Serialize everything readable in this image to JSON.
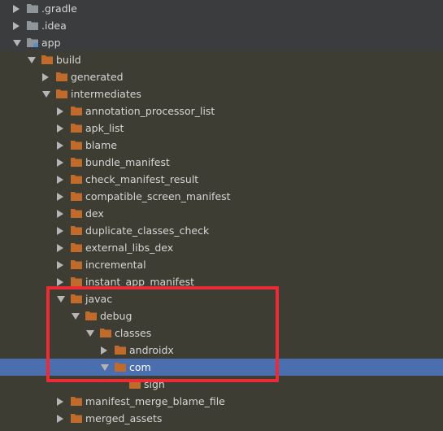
{
  "colors": {
    "background": "#3e3d33",
    "selection": "#4b6eaf",
    "folder_orange": "#c06a2c",
    "folder_gray": "#8f969a",
    "text": "#d6d6d6",
    "annotation_red": "#ec2b35"
  },
  "tree": {
    "rows": [
      {
        "label": ".gradle",
        "expanded": false,
        "icon": "folder-gray-icon"
      },
      {
        "label": ".idea",
        "expanded": false,
        "icon": "folder-gray-icon"
      },
      {
        "label": "app",
        "expanded": true,
        "icon": "module-folder-icon"
      },
      {
        "label": "build",
        "expanded": true,
        "icon": "folder-orange-icon"
      },
      {
        "label": "generated",
        "expanded": false,
        "icon": "folder-orange-icon"
      },
      {
        "label": "intermediates",
        "expanded": true,
        "icon": "folder-orange-icon"
      },
      {
        "label": "annotation_processor_list",
        "expanded": false,
        "icon": "folder-orange-icon"
      },
      {
        "label": "apk_list",
        "expanded": false,
        "icon": "folder-orange-icon"
      },
      {
        "label": "blame",
        "expanded": false,
        "icon": "folder-orange-icon"
      },
      {
        "label": "bundle_manifest",
        "expanded": false,
        "icon": "folder-orange-icon"
      },
      {
        "label": "check_manifest_result",
        "expanded": false,
        "icon": "folder-orange-icon"
      },
      {
        "label": "compatible_screen_manifest",
        "expanded": false,
        "icon": "folder-orange-icon"
      },
      {
        "label": "dex",
        "expanded": false,
        "icon": "folder-orange-icon"
      },
      {
        "label": "duplicate_classes_check",
        "expanded": false,
        "icon": "folder-orange-icon"
      },
      {
        "label": "external_libs_dex",
        "expanded": false,
        "icon": "folder-orange-icon"
      },
      {
        "label": "incremental",
        "expanded": false,
        "icon": "folder-orange-icon"
      },
      {
        "label": "instant_app_manifest",
        "expanded": false,
        "icon": "folder-orange-icon"
      },
      {
        "label": "javac",
        "expanded": true,
        "icon": "folder-orange-icon"
      },
      {
        "label": "debug",
        "expanded": true,
        "icon": "folder-orange-icon"
      },
      {
        "label": "classes",
        "expanded": true,
        "icon": "folder-orange-icon"
      },
      {
        "label": "androidx",
        "expanded": false,
        "icon": "folder-orange-icon"
      },
      {
        "label": "com",
        "expanded": true,
        "icon": "folder-orange-icon",
        "selected": true
      },
      {
        "label": "sign",
        "expanded": false,
        "icon": "folder-orange-icon",
        "partial": true
      },
      {
        "label": "manifest_merge_blame_file",
        "expanded": false,
        "icon": "folder-orange-icon"
      },
      {
        "label": "merged_assets",
        "expanded": false,
        "icon": "folder-orange-icon"
      }
    ]
  }
}
